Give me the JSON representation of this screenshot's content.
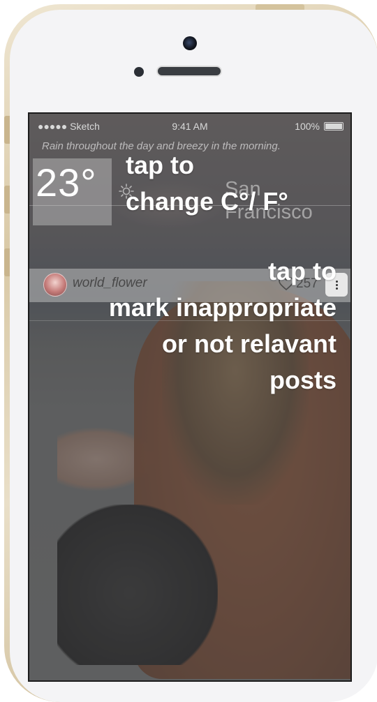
{
  "status_bar": {
    "carrier": "●●●●● Sketch",
    "time": "9:41 AM",
    "battery": "100%"
  },
  "weather": {
    "forecast": "Rain throughout the day and breezy in the morning.",
    "temperature": "23°",
    "city": "San Francisco",
    "icon": "sun-icon"
  },
  "post": {
    "username": "world_flower",
    "likes": "257",
    "like_icon": "heart-icon",
    "more_icon": "vertical-dots-icon"
  },
  "tutorial": {
    "temp_hint_line1": "tap to",
    "temp_hint_line2": "change C°/ F°",
    "more_hint_line1": "tap to",
    "more_hint_line2": "mark inappropriate",
    "more_hint_line3": "or not relavant",
    "more_hint_line4": "posts"
  },
  "colors": {
    "phone_frame": "#d9c9a6",
    "sweater": "#8a4a2c",
    "overlay_text": "#ffffff"
  }
}
